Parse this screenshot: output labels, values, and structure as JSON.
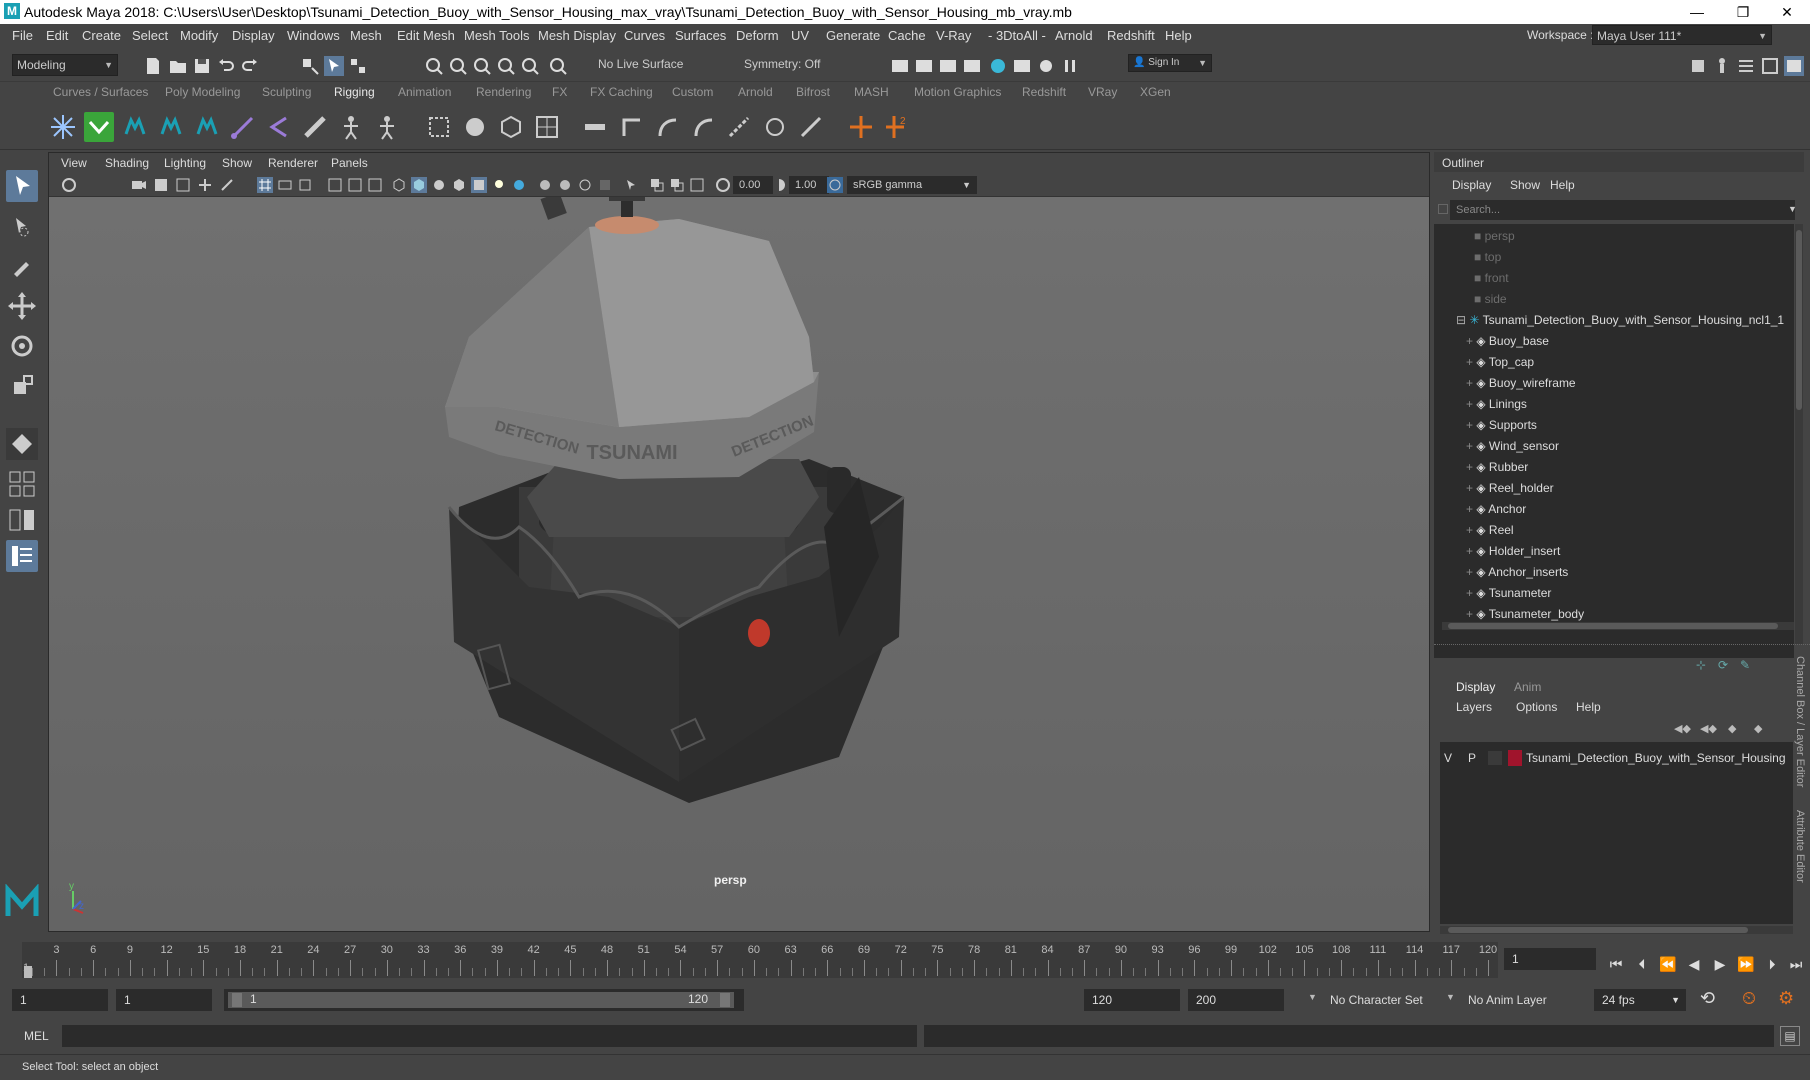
{
  "window": {
    "title": "Autodesk Maya 2018: C:\\Users\\User\\Desktop\\Tsunami_Detection_Buoy_with_Sensor_Housing_max_vray\\Tsunami_Detection_Buoy_with_Sensor_Housing_mb_vray.mb",
    "logo": "M"
  },
  "menubar": [
    "File",
    "Edit",
    "Create",
    "Select",
    "Modify",
    "Display",
    "Windows",
    "Mesh",
    "Edit Mesh",
    "Mesh Tools",
    "Mesh Display",
    "Curves",
    "Surfaces",
    "Deform",
    "UV",
    "Generate",
    "Cache",
    "V-Ray",
    "- 3DtoAll -",
    "Arnold",
    "Redshift",
    "Help"
  ],
  "workspace": {
    "label": "Workspace :",
    "value": "Maya User 111*"
  },
  "statusline": {
    "mode": "Modeling",
    "live_surface": "No Live Surface",
    "symmetry": "Symmetry: Off",
    "sign_in": "Sign In"
  },
  "shelf_tabs": [
    "Curves / Surfaces",
    "Poly Modeling",
    "Sculpting",
    "Rigging",
    "Animation",
    "Rendering",
    "FX",
    "FX Caching",
    "Custom",
    "Arnold",
    "Bifrost",
    "MASH",
    "Motion Graphics",
    "Redshift",
    "VRay",
    "XGen"
  ],
  "active_shelf_tab": "Rigging",
  "viewport": {
    "menu": [
      "View",
      "Shading",
      "Lighting",
      "Show",
      "Renderer",
      "Panels"
    ],
    "exposure": "0.00",
    "gamma": "1.00",
    "color_space": "sRGB gamma",
    "camera": "persp",
    "model_text": {
      "front": "TSUNAMI",
      "left": "DETECTION",
      "right": "DETECTION"
    }
  },
  "outliner": {
    "title": "Outliner",
    "menu": [
      "Display",
      "Show",
      "Help"
    ],
    "search_placeholder": "Search...",
    "cameras": [
      "persp",
      "top",
      "front",
      "side"
    ],
    "root": "Tsunami_Detection_Buoy_with_Sensor_Housing_ncl1_1",
    "children": [
      "Buoy_base",
      "Top_cap",
      "Buoy_wireframe",
      "Linings",
      "Supports",
      "Wind_sensor",
      "Rubber",
      "Reel_holder",
      "Anchor",
      "Reel",
      "Holder_insert",
      "Anchor_inserts",
      "Tsunameter",
      "Tsunameter_body"
    ]
  },
  "layer_editor": {
    "tabs": [
      "Display",
      "Anim"
    ],
    "menu": [
      "Layers",
      "Options",
      "Help"
    ],
    "layer": {
      "v": "V",
      "p": "P",
      "name": "Tsunami_Detection_Buoy_with_Sensor_Housing",
      "color": "#a0142c"
    },
    "side_tabs": [
      "Channel Box / Layer Editor",
      "Attribute Editor"
    ]
  },
  "timeslider": {
    "ticks": [
      "3",
      "6",
      "9",
      "12",
      "15",
      "18",
      "21",
      "24",
      "27",
      "30",
      "33",
      "36",
      "39",
      "42",
      "45",
      "48",
      "51",
      "54",
      "57",
      "60",
      "63",
      "66",
      "69",
      "72",
      "75",
      "78",
      "81",
      "84",
      "87",
      "90",
      "93",
      "96",
      "99",
      "102",
      "105",
      "108",
      "111",
      "114",
      "117",
      "120"
    ],
    "start_label": "1",
    "current_frame": "1"
  },
  "range": {
    "start": "1",
    "anim_start": "1",
    "range_start": "1",
    "range_end": "120",
    "anim_end_field": "120",
    "end": "200",
    "character_set": "No Character Set",
    "anim_layer": "No Anim Layer",
    "fps": "24 fps"
  },
  "cmdline": {
    "label": "MEL"
  },
  "helpline": {
    "text": "Select Tool: select an object"
  },
  "colors": {
    "accent": "#5d7a9a",
    "shelf_green": "#3aa53a",
    "maya_teal": "#1aa0b4"
  }
}
